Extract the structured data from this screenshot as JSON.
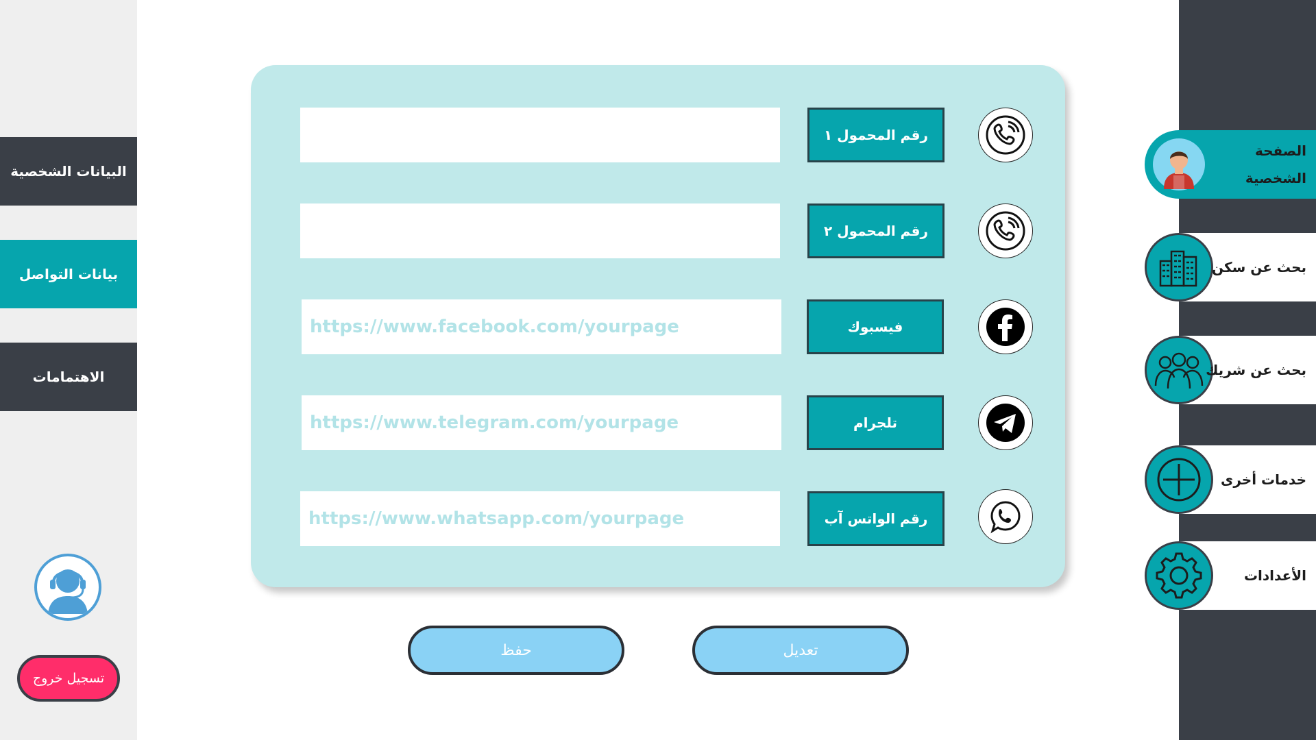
{
  "left_nav": {
    "items": [
      {
        "label": "البيانات الشخصية"
      },
      {
        "label": "بيانات التواصل"
      },
      {
        "label": "الاهتمامات"
      }
    ],
    "logout_label": "تسجيل خروج"
  },
  "right_nav": {
    "items": [
      {
        "label": "الصفحة الشخصية",
        "icon": "user-avatar-icon"
      },
      {
        "label": "بحث عن سكن",
        "icon": "buildings-icon"
      },
      {
        "label": "بحث عن شريك",
        "icon": "people-group-icon"
      },
      {
        "label": "خدمات أخرى",
        "icon": "plus-circle-icon"
      },
      {
        "label": "الأعدادات",
        "icon": "gear-icon"
      }
    ]
  },
  "contact_form": {
    "rows": [
      {
        "label": "رقم المحمول ١",
        "value": "",
        "placeholder": "",
        "icon": "phone-icon"
      },
      {
        "label": "رقم المحمول ٢",
        "value": "",
        "placeholder": "",
        "icon": "phone-icon"
      },
      {
        "label": "فيسبوك",
        "value": "",
        "placeholder": "https://www.facebook.com/yourpage",
        "icon": "facebook-icon"
      },
      {
        "label": "تلجرام",
        "value": "",
        "placeholder": "https://www.telegram.com/yourpage",
        "icon": "telegram-icon"
      },
      {
        "label": "رقم  الواتس آب",
        "value": "",
        "placeholder": "https://www.whatsapp.com/yourpage",
        "icon": "whatsapp-icon"
      }
    ]
  },
  "actions": {
    "save_label": "حفظ",
    "edit_label": "تعديل"
  },
  "colors": {
    "accent": "#06a5ad",
    "dark": "#3a3f47",
    "card": "#c0e9ea",
    "button": "#8ad2f5",
    "logout": "#ff2d6a"
  }
}
